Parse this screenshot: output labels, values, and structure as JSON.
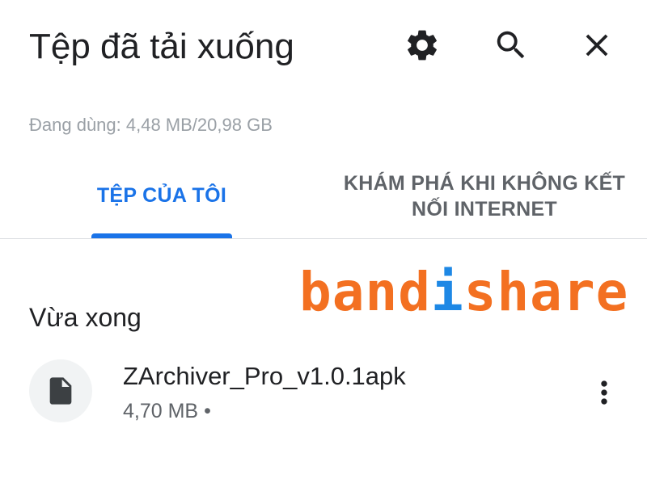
{
  "header": {
    "title": "Tệp đã tải xuống",
    "icons": [
      "gear-icon",
      "search-icon",
      "close-icon"
    ]
  },
  "storage": {
    "label": "Đang dùng: 4,48 MB/20,98 GB"
  },
  "tabs": [
    {
      "label": "TỆP CỦA TÔI",
      "active": true
    },
    {
      "label": "KHÁM PHÁ KHI KHÔNG KẾT NỐI INTERNET",
      "active": false
    }
  ],
  "watermark": {
    "part1": "band",
    "part2": "i",
    "part3": "share"
  },
  "section": {
    "title": "Vừa xong"
  },
  "files": [
    {
      "name": "ZArchiver_Pro_v1.0.1apk",
      "size": "4,70 MB",
      "separator": "•",
      "icon": "file-icon",
      "menu_icon": "more-vert-icon"
    }
  ],
  "colors": {
    "accent": "#1a73e8",
    "text_primary": "#202124",
    "text_secondary": "#5f6368",
    "text_muted": "#9aa0a6",
    "watermark_orange": "#f37021",
    "watermark_blue": "#1e88e5"
  }
}
